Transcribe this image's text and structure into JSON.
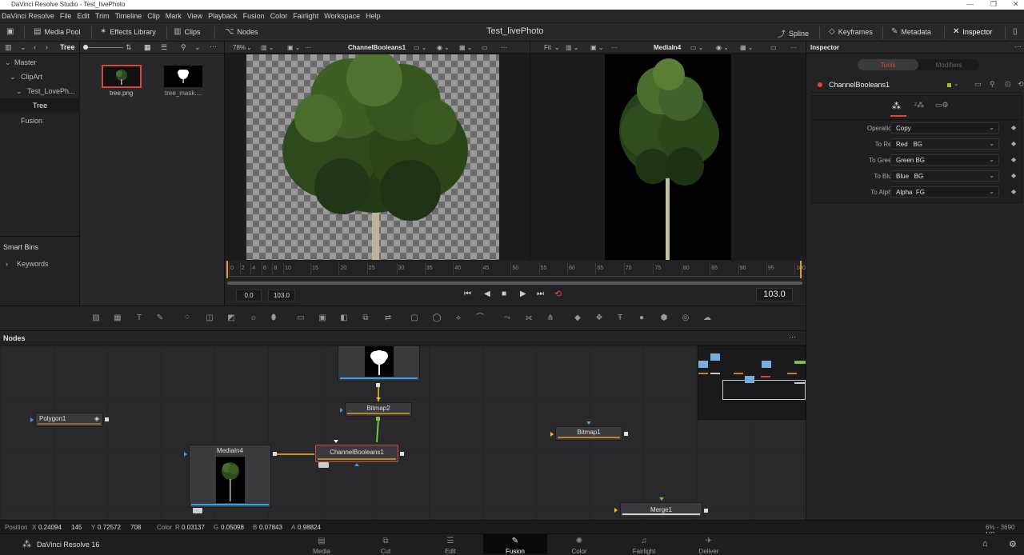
{
  "window": {
    "title": "DaVinci Resolve Studio - Test_livePhoto"
  },
  "menu": [
    "DaVinci Resolve",
    "File",
    "Edit",
    "Trim",
    "Timeline",
    "Clip",
    "Mark",
    "View",
    "Playback",
    "Fusion",
    "Color",
    "Fairlight",
    "Workspace",
    "Help"
  ],
  "toolbar": {
    "media_pool": "Media Pool",
    "effects_library": "Effects Library",
    "clips": "Clips",
    "nodes": "Nodes",
    "project_title": "Test_livePhoto",
    "spline": "Spline",
    "keyframes": "Keyframes",
    "metadata": "Metadata",
    "inspector": "Inspector"
  },
  "pool_header": {
    "bin_name": "Tree"
  },
  "bins": {
    "master": "Master",
    "clipart": "ClipArt",
    "test": "Test_LovePh...",
    "tree": "Tree",
    "fusion": "Fusion",
    "smart_bins": "Smart Bins",
    "keywords": "Keywords"
  },
  "clips": [
    {
      "name": "tree.png"
    },
    {
      "name": "tree_mask...."
    }
  ],
  "viewer1": {
    "zoom": "78%",
    "node": "ChannelBooleans1"
  },
  "viewer2": {
    "zoom": "Fit",
    "node": "MediaIn4"
  },
  "timeline_ticks": [
    "0",
    "2",
    "4",
    "6",
    "8",
    "10",
    "15",
    "20",
    "25",
    "30",
    "35",
    "40",
    "45",
    "50",
    "55",
    "60",
    "65",
    "70",
    "75",
    "80",
    "85",
    "90",
    "95",
    "100"
  ],
  "transport": {
    "start": "0.0",
    "end": "103.0",
    "current": "103.0"
  },
  "inspector": {
    "title": "Inspector",
    "tab_tools": "Tools",
    "tab_modifiers": "Modifiers",
    "node_name": "ChannelBooleans1",
    "params": [
      {
        "label": "Operation",
        "value": "Copy"
      },
      {
        "label": "To Red",
        "value": "Red   BG"
      },
      {
        "label": "To Green",
        "value": "Green BG"
      },
      {
        "label": "To Blue",
        "value": "Blue   BG"
      },
      {
        "label": "To Alpha",
        "value": "Alpha  FG"
      }
    ]
  },
  "nodes_panel": {
    "title": "Nodes"
  },
  "nodes": {
    "polygon1": "Polygon1",
    "bitmap2": "Bitmap2",
    "mediain4": "MediaIn4",
    "channelbooleans1": "ChannelBooleans1",
    "bitmap1": "Bitmap1",
    "merge1": "Merge1"
  },
  "status": {
    "position": "Position",
    "x_label": "X",
    "x": "0.24094",
    "xi": "145",
    "y_label": "Y",
    "y": "0.72572",
    "yi": "708",
    "color": "Color",
    "r_label": "R",
    "r": "0.03137",
    "g_label": "G",
    "g": "0.05098",
    "b_label": "B",
    "b": "0.07843",
    "a_label": "A",
    "a": "0.98824",
    "mem": "6% - 3690 MB"
  },
  "app": {
    "name": "DaVinci Resolve 16"
  },
  "pages": [
    "Media",
    "Cut",
    "Edit",
    "Fusion",
    "Color",
    "Fairlight",
    "Deliver"
  ],
  "colors": {
    "accent_red": "#e0453a",
    "active_page": "#0a0a0a",
    "node_border_selected": "#c84a3a",
    "link_yellow": "#f0c020",
    "link_green": "#7ac142"
  }
}
